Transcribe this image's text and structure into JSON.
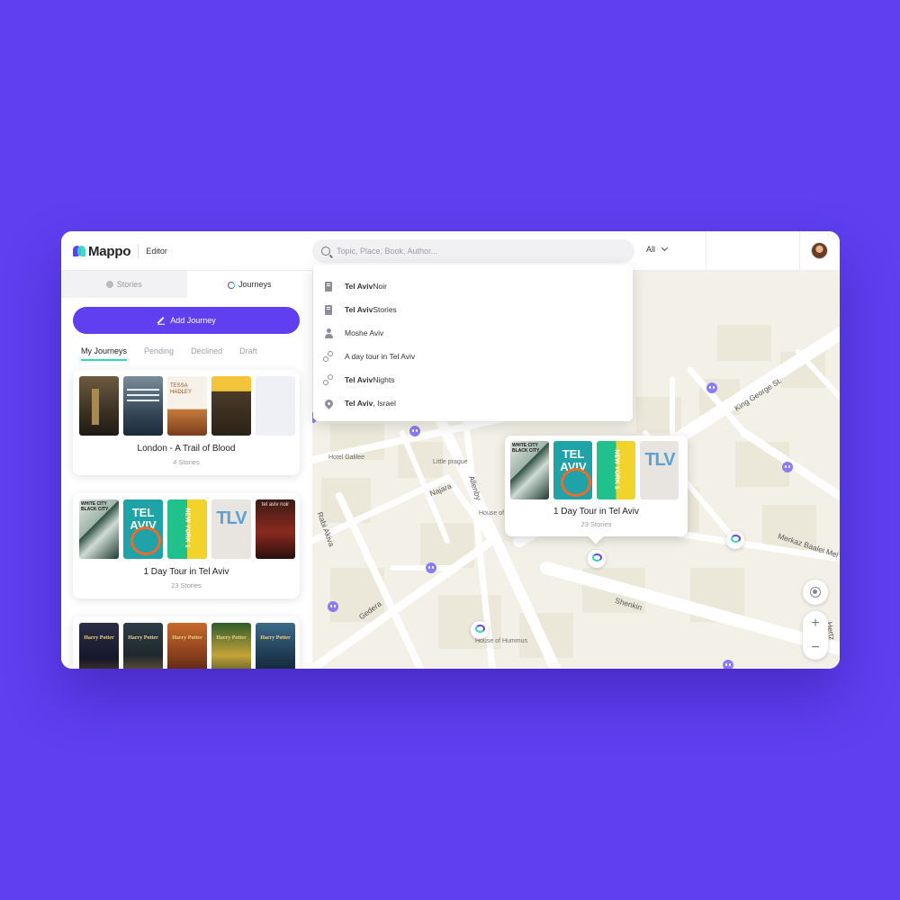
{
  "header": {
    "brand": "Mappo",
    "section": "Editor",
    "search_placeholder": "Topic, Place, Book, Author...",
    "filter_label": "All"
  },
  "sidebar": {
    "tabs": [
      {
        "label": "Stories",
        "icon": "stories-icon"
      },
      {
        "label": "Journeys",
        "icon": "journeys-icon"
      }
    ],
    "add_button": "Add Journey",
    "subtabs": [
      "My Journeys",
      "Pending",
      "Declined",
      "Draft"
    ],
    "cards": [
      {
        "title": "London - A Trail of Blood",
        "subtitle": "4 Stories"
      },
      {
        "title": "1 Day Tour in Tel Aviv",
        "subtitle": "23 Stories"
      },
      {
        "title": "",
        "subtitle": ""
      }
    ]
  },
  "search_results": [
    {
      "bold": "Tel Aviv",
      "rest": " Noir",
      "icon": "book-icon"
    },
    {
      "bold": "Tel Aviv",
      "rest": " Stories",
      "icon": "book-icon"
    },
    {
      "bold": "",
      "rest": "Moshe Aviv",
      "icon": "person-icon"
    },
    {
      "bold": "",
      "rest": "A day tour in Tel Aviv",
      "icon": "route-icon"
    },
    {
      "bold": "Tel Aviv",
      "rest": " Nights",
      "icon": "route-icon"
    },
    {
      "bold": "Tel Aviv",
      "rest": ", Israel",
      "icon": "pin-icon"
    }
  ],
  "map": {
    "labels": {
      "hotel": "Hotel Galilee",
      "little_prague": "Little prague",
      "house_of": "House of",
      "house_of_hummus": "House of Hummus"
    },
    "streets": {
      "king_george": "King George St.",
      "allenby": "Allenby",
      "najara": "Najara",
      "rabi_akiva": "Rabi Akiva",
      "merkaz": "Merkaz Baalei Mel",
      "shenkin": "Shenkin",
      "gedera": "Gedera",
      "edge": "Hertz"
    },
    "popup": {
      "title": "1 Day Tour in Tel Aviv",
      "subtitle": "23 Stories"
    },
    "zoom_in": "+",
    "zoom_out": "−"
  },
  "colors": {
    "accent": "#5f3ff0",
    "teal": "#35d3c4",
    "background": "#5f3ff0"
  }
}
